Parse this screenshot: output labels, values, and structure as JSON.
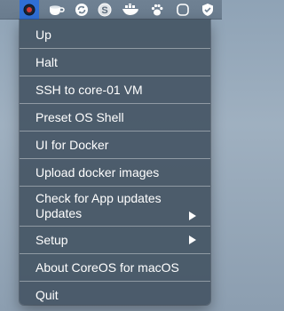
{
  "menubar": {
    "icons": [
      "coreos-logo-icon",
      "coffee-cup-icon",
      "sync-icon",
      "dollar-circle-icon",
      "docker-whale-icon",
      "paw-icon",
      "rounded-square-icon",
      "shield-check-icon"
    ]
  },
  "menu": {
    "up": "Up",
    "halt": "Halt",
    "ssh": "SSH to core-01 VM",
    "preset_shell": "Preset OS Shell",
    "ui_docker": "UI for Docker",
    "upload_images": "Upload docker images",
    "check_updates": "Check for App updates",
    "updates": "Updates",
    "setup": "Setup",
    "about": "About CoreOS for macOS",
    "quit": "Quit"
  },
  "colors": {
    "menu_bg": "#465665",
    "menubar_bg": "#6f8193",
    "active_icon_bg": "#2f6fd6",
    "text": "#ffffff"
  }
}
